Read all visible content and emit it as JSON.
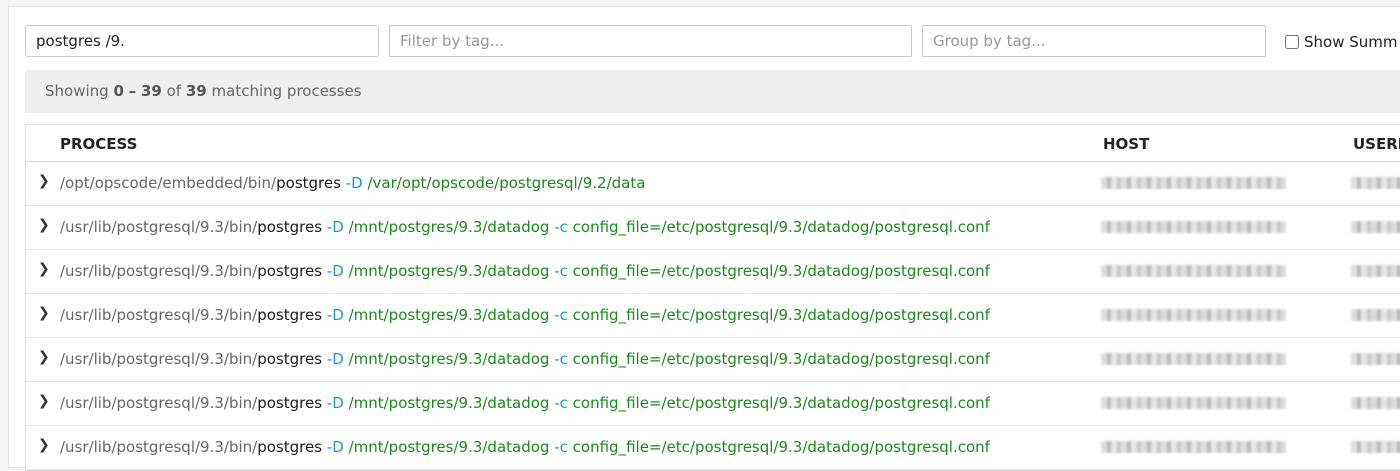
{
  "search": {
    "value": "postgres /9.",
    "filter_placeholder": "Filter by tag...",
    "group_placeholder": "Group by tag...",
    "show_summary_label": "Show Summ"
  },
  "status": {
    "prefix": "Showing",
    "start": "0",
    "dash": "–",
    "end": "39",
    "of": "of",
    "total": "39",
    "suffix": "matching processes"
  },
  "columns": {
    "process": "PROCESS",
    "host": "HOST",
    "user": "USERN"
  },
  "rows": [
    {
      "path": "/opt/opscode/embedded/bin/",
      "bin": "postgres",
      "f1": "-D",
      "a1": "/var/opt/opscode/postgresql/9.2/data",
      "f2": "",
      "a2": ""
    },
    {
      "path": "/usr/lib/postgresql/9.3/bin/",
      "bin": "postgres",
      "f1": "-D",
      "a1": "/mnt/postgres/9.3/datadog",
      "f2": "-c",
      "a2": "config_file=/etc/postgresql/9.3/datadog/postgresql.conf"
    },
    {
      "path": "/usr/lib/postgresql/9.3/bin/",
      "bin": "postgres",
      "f1": "-D",
      "a1": "/mnt/postgres/9.3/datadog",
      "f2": "-c",
      "a2": "config_file=/etc/postgresql/9.3/datadog/postgresql.conf"
    },
    {
      "path": "/usr/lib/postgresql/9.3/bin/",
      "bin": "postgres",
      "f1": "-D",
      "a1": "/mnt/postgres/9.3/datadog",
      "f2": "-c",
      "a2": "config_file=/etc/postgresql/9.3/datadog/postgresql.conf"
    },
    {
      "path": "/usr/lib/postgresql/9.3/bin/",
      "bin": "postgres",
      "f1": "-D",
      "a1": "/mnt/postgres/9.3/datadog",
      "f2": "-c",
      "a2": "config_file=/etc/postgresql/9.3/datadog/postgresql.conf"
    },
    {
      "path": "/usr/lib/postgresql/9.3/bin/",
      "bin": "postgres",
      "f1": "-D",
      "a1": "/mnt/postgres/9.3/datadog",
      "f2": "-c",
      "a2": "config_file=/etc/postgresql/9.3/datadog/postgresql.conf"
    },
    {
      "path": "/usr/lib/postgresql/9.3/bin/",
      "bin": "postgres",
      "f1": "-D",
      "a1": "/mnt/postgres/9.3/datadog",
      "f2": "-c",
      "a2": "config_file=/etc/postgresql/9.3/datadog/postgresql.conf"
    }
  ],
  "colors": {
    "flag": "#1a9ad6",
    "arg": "#1b8a1b",
    "path": "#666666"
  }
}
